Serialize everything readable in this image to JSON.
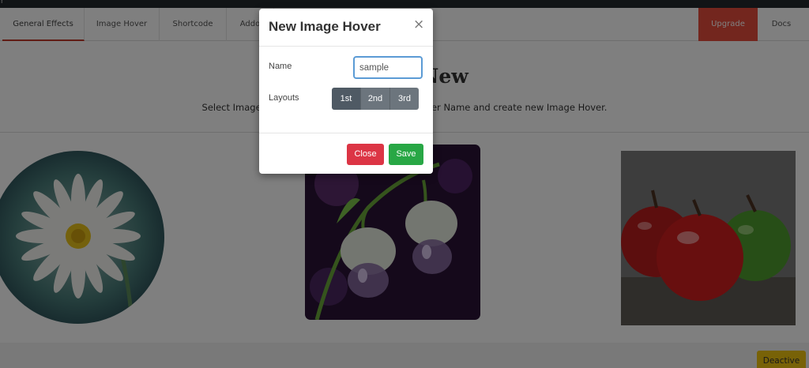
{
  "topbar": {
    "mark": "r"
  },
  "tabs": [
    {
      "label": "General Effects",
      "active": true
    },
    {
      "label": "Image Hover",
      "active": false
    },
    {
      "label": "Shortcode",
      "active": false
    },
    {
      "label": "Addo",
      "active": false
    }
  ],
  "nav_right": {
    "upgrade_label": "Upgrade",
    "docs_label": "Docs"
  },
  "hero": {
    "title": "Create New",
    "subtitle": "Select Image Hover Layouts, Give your Image Hover Name and create new Image Hover."
  },
  "gallery": {
    "items": [
      {
        "icon": "daisy-image"
      },
      {
        "icon": "water-drop-flower-image"
      },
      {
        "icon": "apples-image"
      }
    ]
  },
  "footer": {
    "deactive_label": "Deactive"
  },
  "modal": {
    "title": "New Image Hover",
    "close_icon": "×",
    "name_label": "Name",
    "name_value": "sample",
    "layouts_label": "Layouts",
    "layouts": [
      {
        "label": "1st",
        "active": true
      },
      {
        "label": "2nd",
        "active": false
      },
      {
        "label": "3rd",
        "active": false
      }
    ],
    "close_button": "Close",
    "save_button": "Save"
  },
  "colors": {
    "upgrade": "#e74c3c",
    "close_button": "#dc3545",
    "save_button": "#28a745",
    "deactive": "#f1c40f",
    "input_focus": "#5b9bd5"
  }
}
